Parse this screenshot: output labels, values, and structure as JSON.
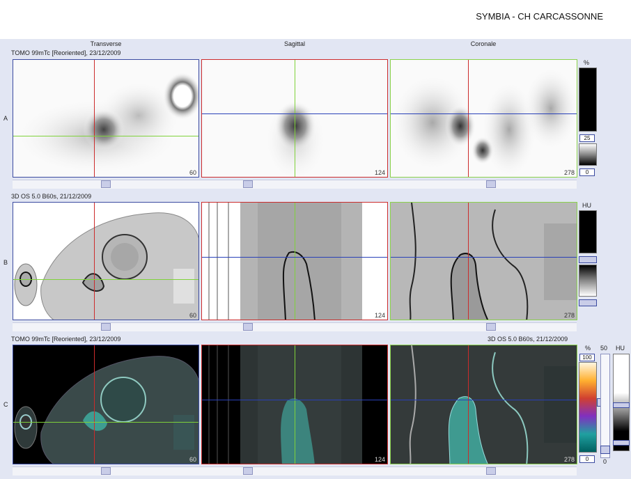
{
  "header": {
    "title": "SYMBIA - CH CARCASSONNE"
  },
  "columns": {
    "transverse": "Transverse",
    "sagittal": "Sagittal",
    "coronal": "Coronale"
  },
  "rows": {
    "a": {
      "letter": "A",
      "series": "TOMO 99mTc [Reoriented], 23/12/2009",
      "slices": [
        "60",
        "124",
        "278"
      ],
      "scale_unit": "%",
      "scale_mid": "25",
      "scale_low": "0"
    },
    "b": {
      "letter": "B",
      "series": "3D  OS  5.0  B60s, 21/12/2009",
      "slices": [
        "60",
        "124",
        "278"
      ],
      "scale_unit": "HU"
    },
    "c": {
      "letter": "C",
      "series_left": "TOMO 99mTc [Reoriented], 23/12/2009",
      "series_right": "3D  OS  5.0  B60s, 21/12/2009",
      "slices": [
        "60",
        "124",
        "278"
      ],
      "scale_unit_pct": "%",
      "scale_50": "50",
      "scale_unit_hu": "HU",
      "scale_100": "100",
      "scale_low": "0",
      "scale_zero": "0"
    }
  },
  "colors": {
    "crosshair_red": "#cc2b2b",
    "crosshair_green": "#7fd23a",
    "crosshair_blue": "#2840b8",
    "panel_bg": "#e2e6f3"
  },
  "icons": [
    "slider-thumb-icon"
  ]
}
